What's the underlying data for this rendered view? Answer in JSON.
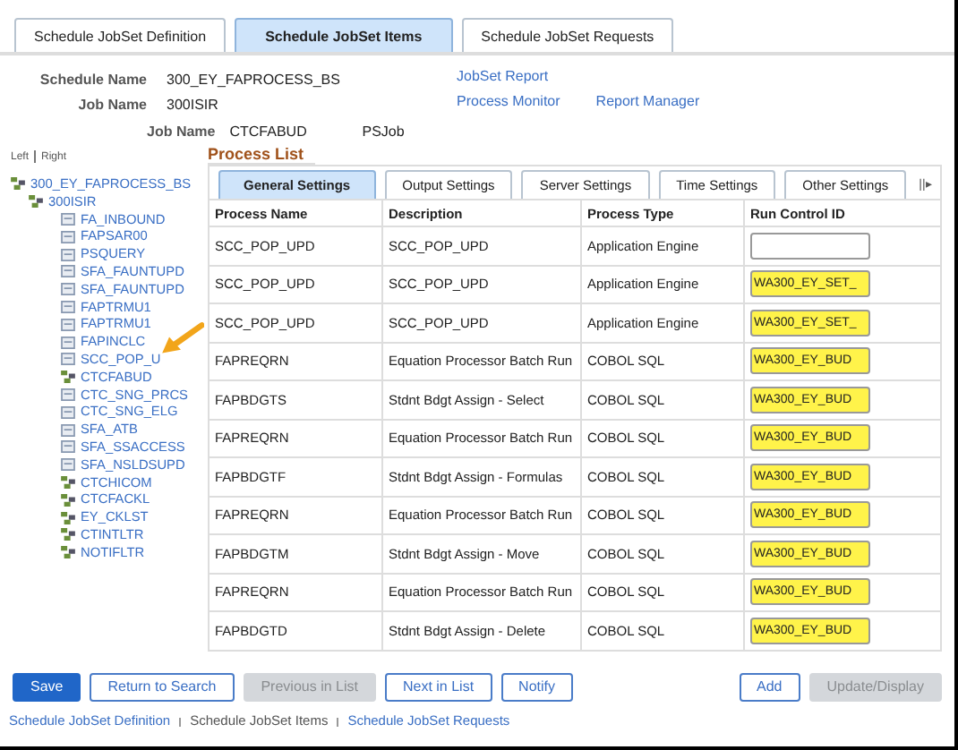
{
  "top_tabs": [
    {
      "label": "Schedule JobSet Definition",
      "selected": false
    },
    {
      "label": "Schedule JobSet Items",
      "selected": true
    },
    {
      "label": "Schedule JobSet Requests",
      "selected": false
    }
  ],
  "header": {
    "fields": [
      {
        "label": "Schedule Name",
        "value": "300_EY_FAPROCESS_BS"
      },
      {
        "label": "Job Name",
        "value": "300ISIR"
      }
    ],
    "links": [
      "JobSet Report",
      "Process Monitor",
      "Report Manager"
    ],
    "job": {
      "label": "Job Name",
      "value": "CTCFABUD",
      "type": "PSJob"
    }
  },
  "tree_toggle": [
    "Left",
    "Right"
  ],
  "tree": [
    {
      "label": "300_EY_FAPROCESS_BS",
      "kind": "job",
      "children": [
        {
          "label": "300ISIR",
          "kind": "job",
          "children": [
            {
              "label": "FA_INBOUND",
              "kind": "process"
            },
            {
              "label": "FAPSAR00",
              "kind": "process"
            },
            {
              "label": "PSQUERY",
              "kind": "process"
            },
            {
              "label": "SFA_FAUNTUPD",
              "kind": "process"
            },
            {
              "label": "SFA_FAUNTUPD",
              "kind": "process"
            },
            {
              "label": "FAPTRMU1",
              "kind": "process"
            },
            {
              "label": "FAPTRMU1",
              "kind": "process"
            },
            {
              "label": "FAPINCLC",
              "kind": "process"
            },
            {
              "label": "SCC_POP_U",
              "kind": "process"
            },
            {
              "label": "CTCFABUD",
              "kind": "job"
            },
            {
              "label": "CTC_SNG_PRCS",
              "kind": "process"
            },
            {
              "label": "CTC_SNG_ELG",
              "kind": "process"
            },
            {
              "label": "SFA_ATB",
              "kind": "process"
            },
            {
              "label": "SFA_SSACCESS",
              "kind": "process"
            },
            {
              "label": "SFA_NSLDSUPD",
              "kind": "process"
            },
            {
              "label": "CTCHICOM",
              "kind": "job"
            },
            {
              "label": "CTCFACKL",
              "kind": "job"
            },
            {
              "label": "EY_CKLST",
              "kind": "job"
            },
            {
              "label": "CTINTLTR",
              "kind": "job"
            },
            {
              "label": "NOTIFLTR",
              "kind": "job"
            }
          ]
        }
      ]
    }
  ],
  "process_list": {
    "title": "Process List",
    "tabs": [
      {
        "label": "General Settings",
        "selected": true
      },
      {
        "label": "Output Settings",
        "selected": false
      },
      {
        "label": "Server Settings",
        "selected": false
      },
      {
        "label": "Time Settings",
        "selected": false
      },
      {
        "label": "Other Settings",
        "selected": false
      }
    ],
    "more_tabs": "||▸",
    "columns": [
      "Process Name",
      "Description",
      "Process Type",
      "Run Control ID"
    ],
    "rows": [
      {
        "name": "SCC_POP_UPD",
        "description": "SCC_POP_UPD",
        "type": "Application Engine",
        "run_control": "",
        "highlighted": false
      },
      {
        "name": "SCC_POP_UPD",
        "description": "SCC_POP_UPD",
        "type": "Application Engine",
        "run_control": "WA300_EY_SET_",
        "highlighted": true
      },
      {
        "name": "SCC_POP_UPD",
        "description": "SCC_POP_UPD",
        "type": "Application Engine",
        "run_control": "WA300_EY_SET_",
        "highlighted": true
      },
      {
        "name": "FAPREQRN",
        "description": "Equation Processor Batch Run",
        "type": "COBOL SQL",
        "run_control": "WA300_EY_BUD",
        "highlighted": true
      },
      {
        "name": "FAPBDGTS",
        "description": "Stdnt Bdgt Assign - Select",
        "type": "COBOL SQL",
        "run_control": "WA300_EY_BUD",
        "highlighted": true
      },
      {
        "name": "FAPREQRN",
        "description": "Equation Processor Batch Run",
        "type": "COBOL SQL",
        "run_control": "WA300_EY_BUD",
        "highlighted": true
      },
      {
        "name": "FAPBDGTF",
        "description": "Stdnt Bdgt Assign - Formulas",
        "type": "COBOL SQL",
        "run_control": "WA300_EY_BUD",
        "highlighted": true
      },
      {
        "name": "FAPREQRN",
        "description": "Equation Processor Batch Run",
        "type": "COBOL SQL",
        "run_control": "WA300_EY_BUD",
        "highlighted": true
      },
      {
        "name": "FAPBDGTM",
        "description": "Stdnt Bdgt Assign - Move",
        "type": "COBOL SQL",
        "run_control": "WA300_EY_BUD",
        "highlighted": true
      },
      {
        "name": "FAPREQRN",
        "description": "Equation Processor Batch Run",
        "type": "COBOL SQL",
        "run_control": "WA300_EY_BUD",
        "highlighted": true
      },
      {
        "name": "FAPBDGTD",
        "description": "Stdnt Bdgt Assign - Delete",
        "type": "COBOL SQL",
        "run_control": "WA300_EY_BUD",
        "highlighted": true
      }
    ]
  },
  "buttons_left": [
    {
      "label": "Save",
      "kind": "primary",
      "disabled": false
    },
    {
      "label": "Return to Search",
      "kind": "secondary",
      "disabled": false
    },
    {
      "label": "Previous in List",
      "kind": "secondary",
      "disabled": true
    },
    {
      "label": "Next in List",
      "kind": "secondary",
      "disabled": false
    },
    {
      "label": "Notify",
      "kind": "secondary",
      "disabled": false
    }
  ],
  "buttons_right": [
    {
      "label": "Add",
      "kind": "secondary",
      "disabled": false
    },
    {
      "label": "Update/Display",
      "kind": "secondary",
      "disabled": true
    }
  ],
  "footer_links": [
    {
      "label": "Schedule JobSet Definition",
      "selected": false
    },
    {
      "label": "Schedule JobSet Items",
      "selected": true
    },
    {
      "label": "Schedule JobSet Requests",
      "selected": false
    }
  ]
}
